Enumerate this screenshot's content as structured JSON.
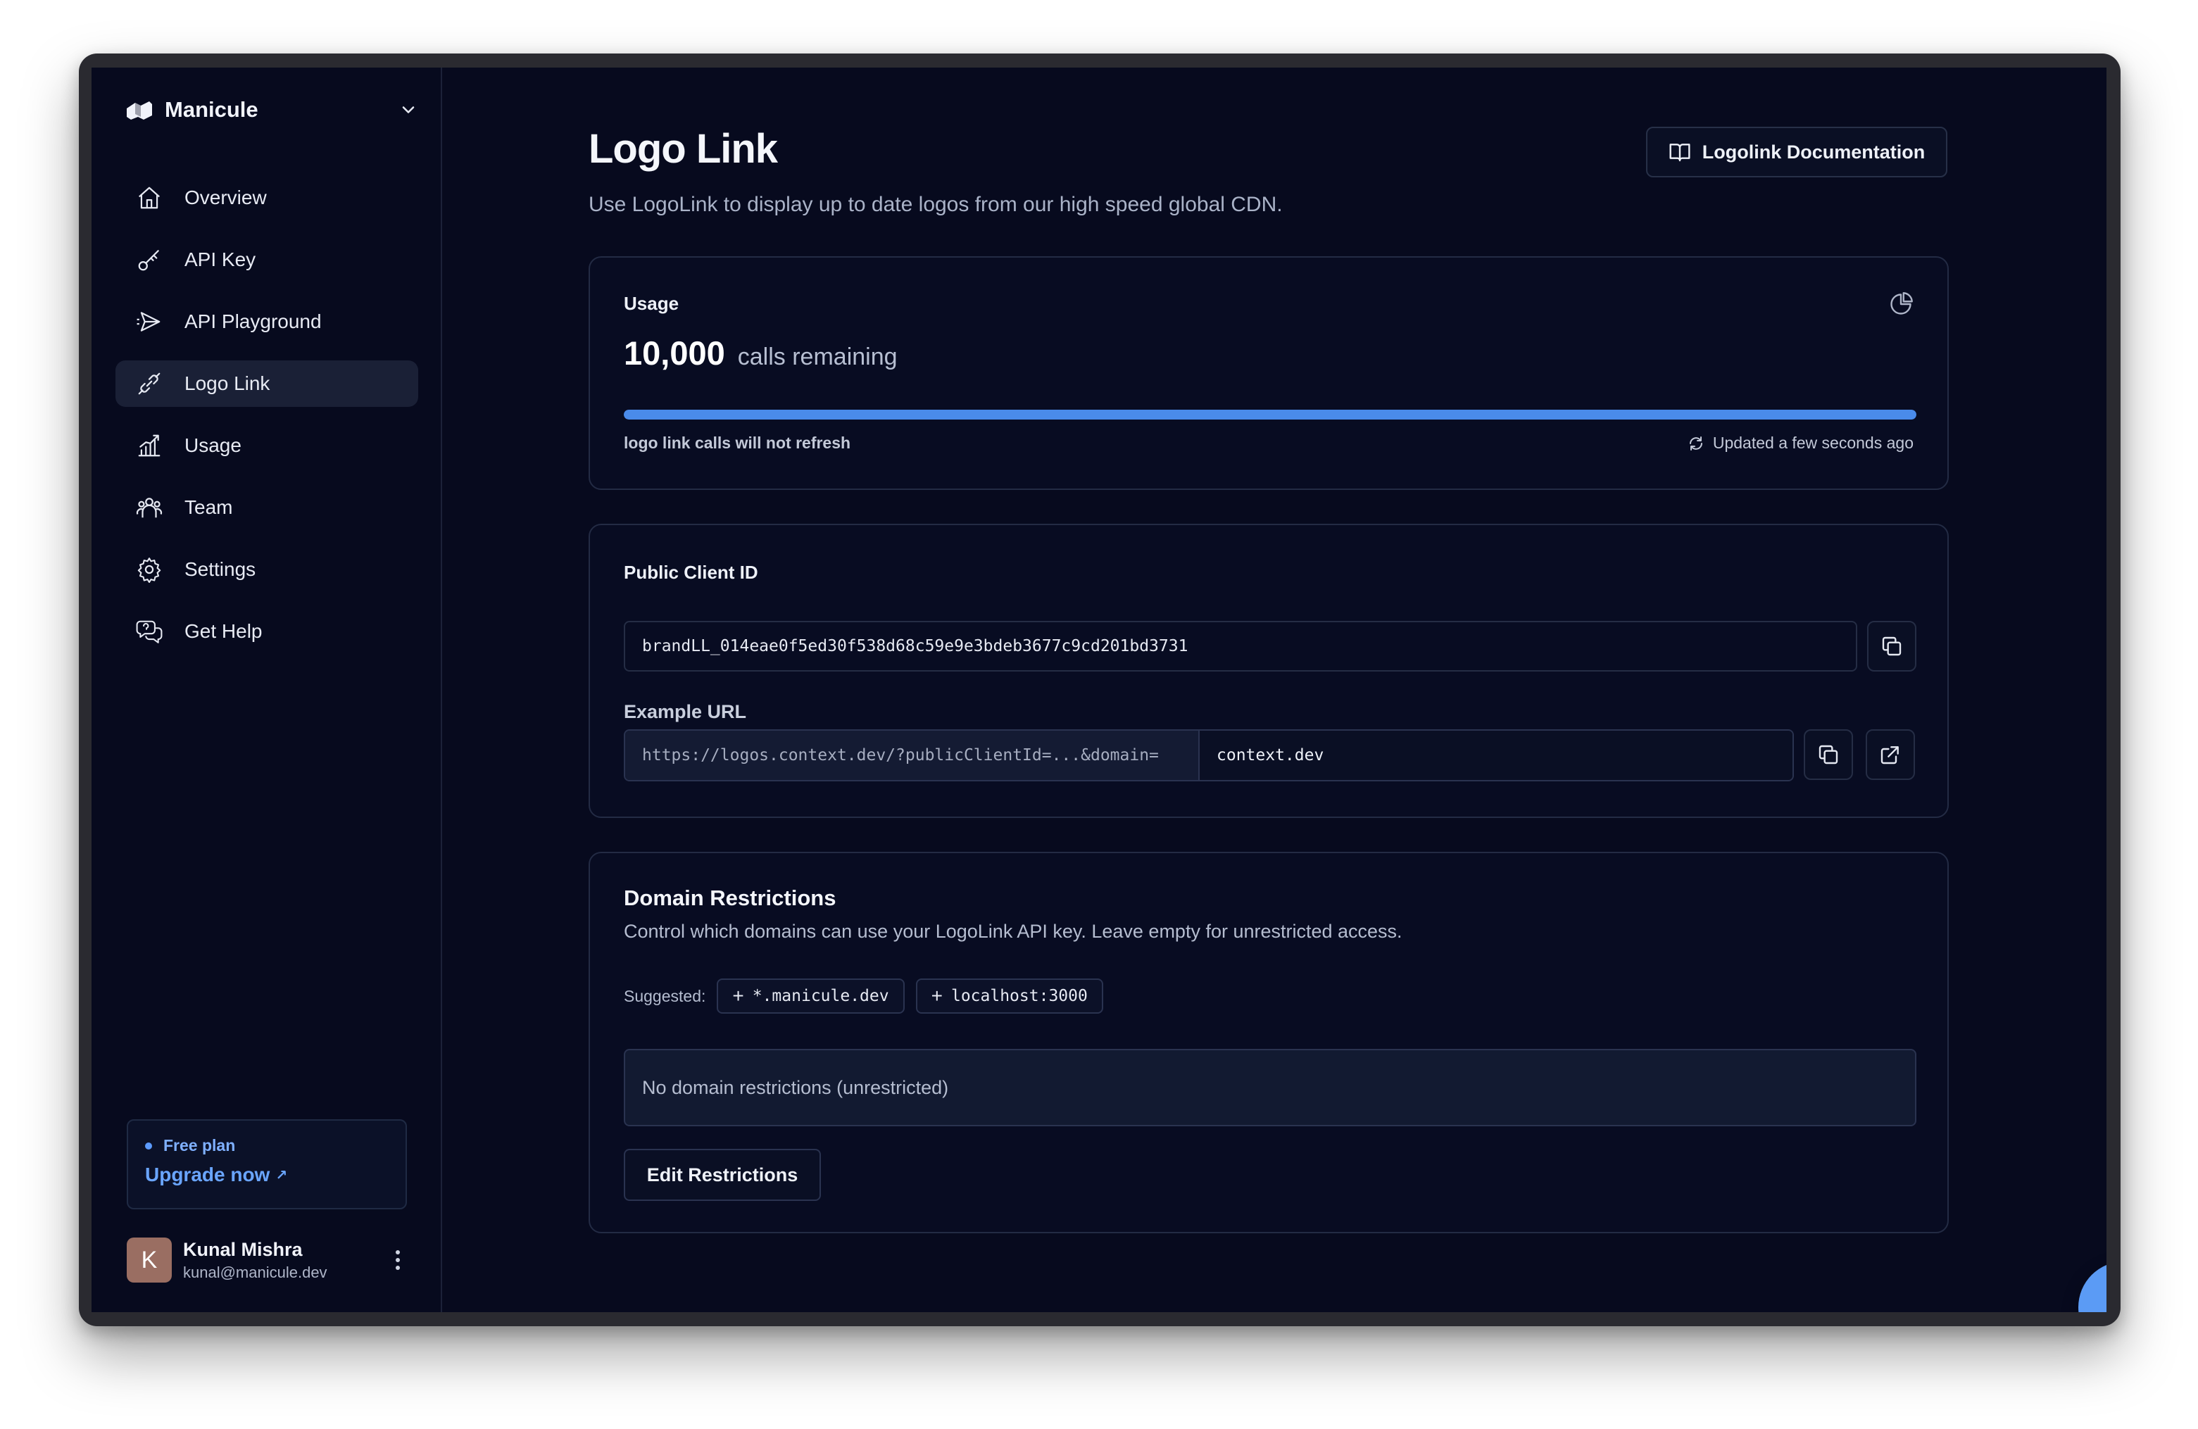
{
  "app": {
    "name": "Manicule"
  },
  "sidebar": {
    "items": [
      {
        "label": "Overview",
        "icon": "home-icon"
      },
      {
        "label": "API Key",
        "icon": "key-icon"
      },
      {
        "label": "API Playground",
        "icon": "paper-plane-icon"
      },
      {
        "label": "Logo Link",
        "icon": "link-icon",
        "active": true
      },
      {
        "label": "Usage",
        "icon": "bar-chart-icon"
      },
      {
        "label": "Team",
        "icon": "team-icon"
      },
      {
        "label": "Settings",
        "icon": "gear-icon"
      },
      {
        "label": "Get Help",
        "icon": "help-chat-icon"
      }
    ],
    "plan": {
      "name": "Free plan",
      "upgrade_label": "Upgrade now",
      "upgrade_arrow": "↗"
    },
    "user": {
      "initial": "K",
      "name": "Kunal Mishra",
      "email": "kunal@manicule.dev"
    }
  },
  "header": {
    "title": "Logo Link",
    "subtitle": "Use LogoLink to display up to date logos from our high speed global CDN.",
    "doc_button_label": "Logolink Documentation"
  },
  "usage": {
    "label": "Usage",
    "count": "10,000",
    "unit": "calls remaining",
    "progress_fraction": 1.0,
    "note": "logo link calls will not refresh",
    "updated": "Updated a few seconds ago"
  },
  "client": {
    "label": "Public Client ID",
    "client_id": "brandLL_014eae0f5ed30f538d68c59e9e3bdeb3677c9cd201bd3731",
    "example_label": "Example URL",
    "url_prefix": "https://logos.context.dev/?publicClientId=...&domain=",
    "url_domain": "context.dev"
  },
  "domain": {
    "title": "Domain Restrictions",
    "description": "Control which domains can use your LogoLink API key. Leave empty for unrestricted access.",
    "suggested_label": "Suggested:",
    "suggestions": [
      "*.manicule.dev",
      "localhost:3000"
    ],
    "restrictions_text": "No domain restrictions (unrestricted)",
    "edit_label": "Edit Restrictions"
  },
  "colors": {
    "background": "#070a1e",
    "accent": "#4a8bea",
    "fab": "#5b9bf5"
  }
}
